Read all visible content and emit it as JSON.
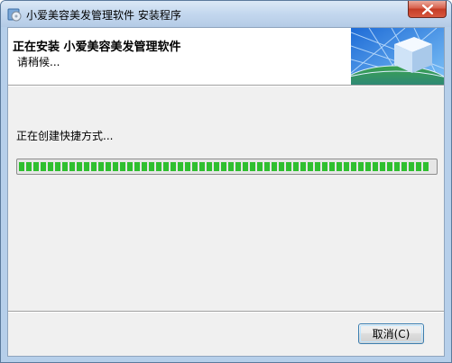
{
  "window": {
    "title": "小爱美容美发管理软件 安装程序",
    "close_icon": "close-icon",
    "app_icon": "installer-cd-icon"
  },
  "header": {
    "title": "正在安装 小爱美容美发管理软件",
    "subtitle": "请稍候...",
    "graphic": "globe-cube-graphic"
  },
  "main": {
    "status": "正在创建快捷方式...",
    "progress_percent": 99
  },
  "footer": {
    "cancel_label": "取消(C)"
  },
  "colors": {
    "progress_green": "#2fbf2f",
    "close_red": "#c43c26",
    "title_bar": "#c3d7ee"
  }
}
